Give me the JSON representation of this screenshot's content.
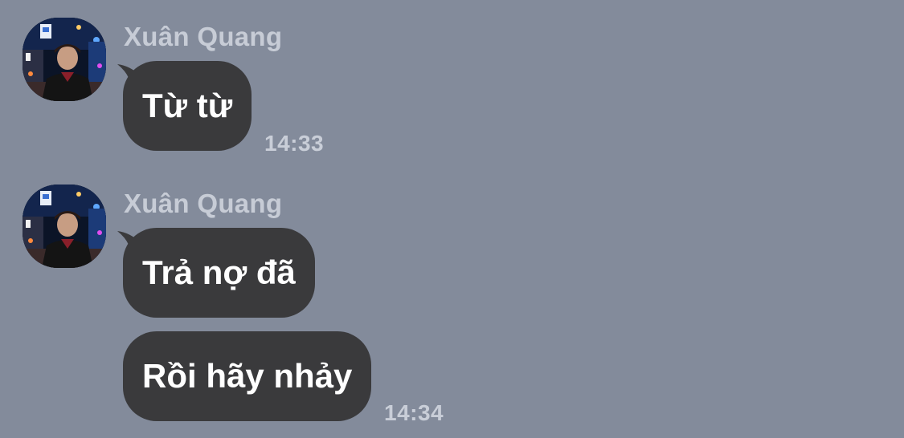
{
  "chat": {
    "background_color": "#838b9b",
    "bubble_color": "#3a3a3c",
    "message_groups": [
      {
        "sender": "Xuân Quang",
        "avatar_icon": "profile-photo-night-city",
        "messages": [
          {
            "text": "Từ từ",
            "time": "14:33"
          }
        ]
      },
      {
        "sender": "Xuân Quang",
        "avatar_icon": "profile-photo-night-city",
        "messages": [
          {
            "text": "Trả nợ đã",
            "time": ""
          },
          {
            "text": "Rồi hãy nhảy",
            "time": "14:34"
          }
        ]
      }
    ]
  }
}
